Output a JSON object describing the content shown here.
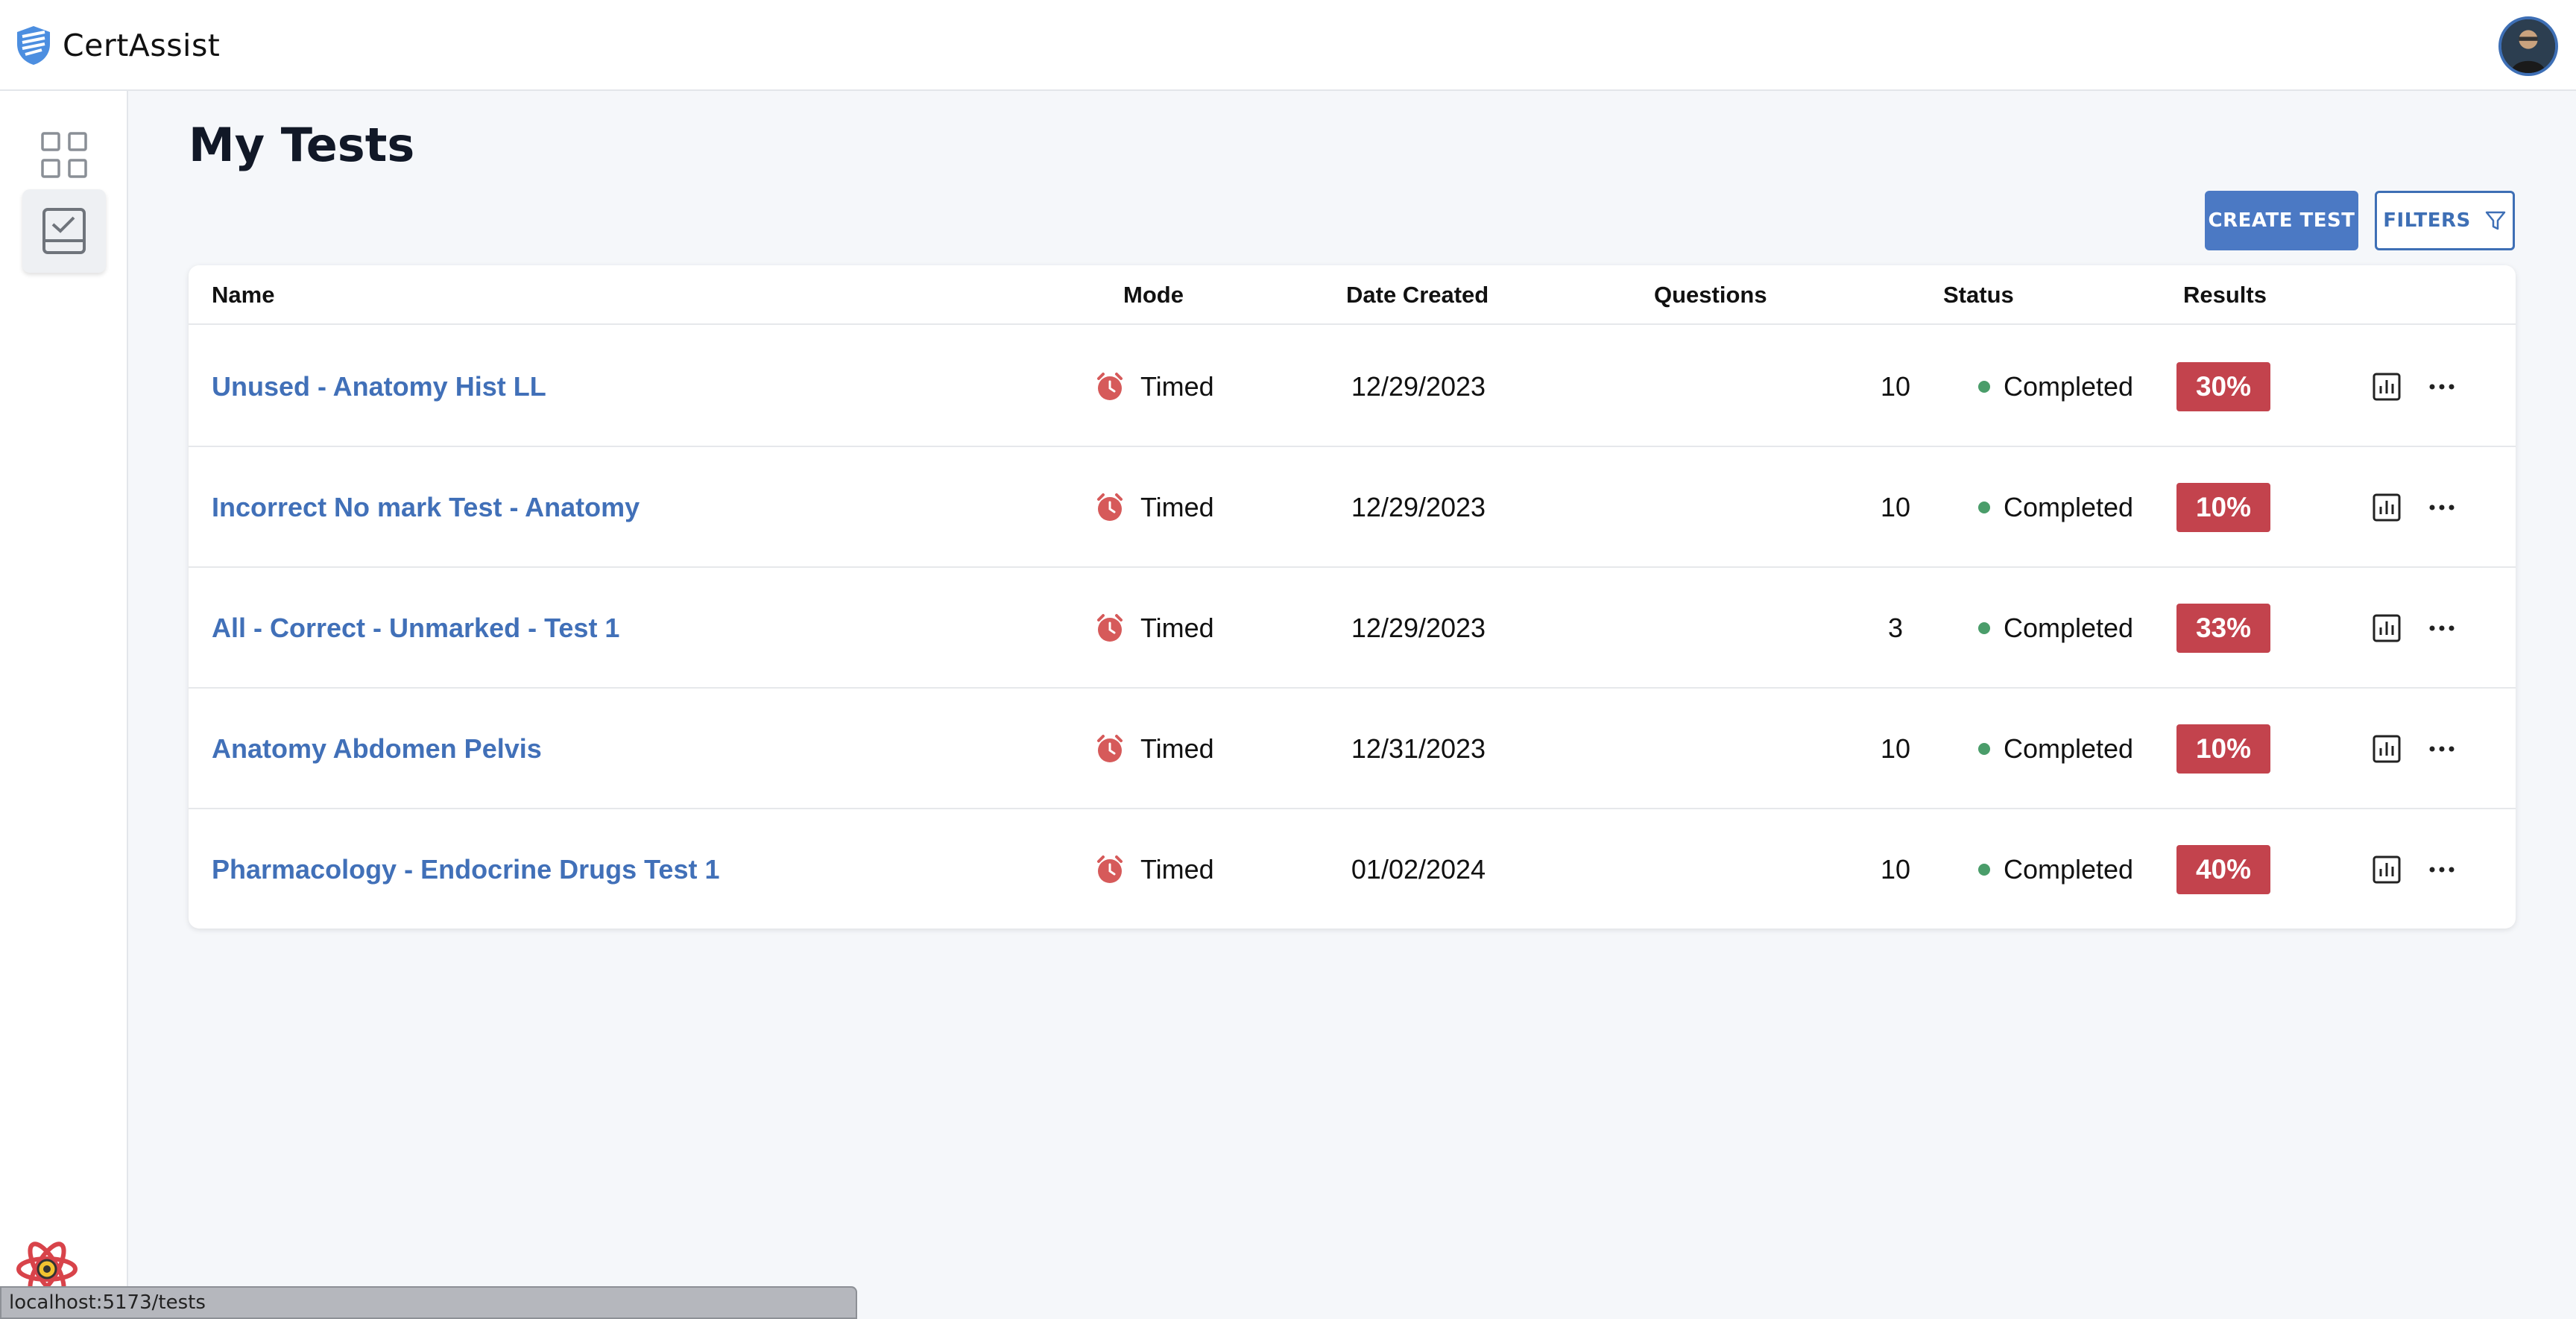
{
  "app": {
    "brand_name": "CertAssist"
  },
  "page": {
    "title": "My Tests"
  },
  "toolbar": {
    "create_label": "CREATE TEST",
    "filters_label": "FILTERS"
  },
  "table": {
    "headers": {
      "name": "Name",
      "mode": "Mode",
      "date": "Date Created",
      "questions": "Questions",
      "status": "Status",
      "results": "Results"
    },
    "rows": [
      {
        "name": "Unused - Anatomy Hist LL",
        "mode": "Timed",
        "date": "12/29/2023",
        "questions": "10",
        "status": "Completed",
        "result": "30%"
      },
      {
        "name": "Incorrect No mark Test - Anatomy",
        "mode": "Timed",
        "date": "12/29/2023",
        "questions": "10",
        "status": "Completed",
        "result": "10%"
      },
      {
        "name": "All - Correct - Unmarked - Test 1",
        "mode": "Timed",
        "date": "12/29/2023",
        "questions": "3",
        "status": "Completed",
        "result": "33%"
      },
      {
        "name": "Anatomy Abdomen Pelvis",
        "mode": "Timed",
        "date": "12/31/2023",
        "questions": "10",
        "status": "Completed",
        "result": "10%"
      },
      {
        "name": "Pharmacology - Endocrine Drugs Test 1",
        "mode": "Timed",
        "date": "01/02/2024",
        "questions": "10",
        "status": "Completed",
        "result": "40%"
      }
    ]
  },
  "statusbar": {
    "url": "localhost:5173/tests"
  },
  "colors": {
    "accent": "#4b79c4",
    "link": "#4170b8",
    "result_badge": "#c3434d",
    "status_dot": "#4a9d6a",
    "timer_icon": "#d65a5a"
  },
  "icons": {
    "brand": "shield-logo-icon",
    "dashboard": "grid-icon",
    "tests": "checklist-icon",
    "filter": "funnel-icon",
    "mode": "alarm-clock-icon",
    "stats": "bar-chart-icon",
    "more": "ellipsis-icon",
    "devtools": "react-icon"
  }
}
